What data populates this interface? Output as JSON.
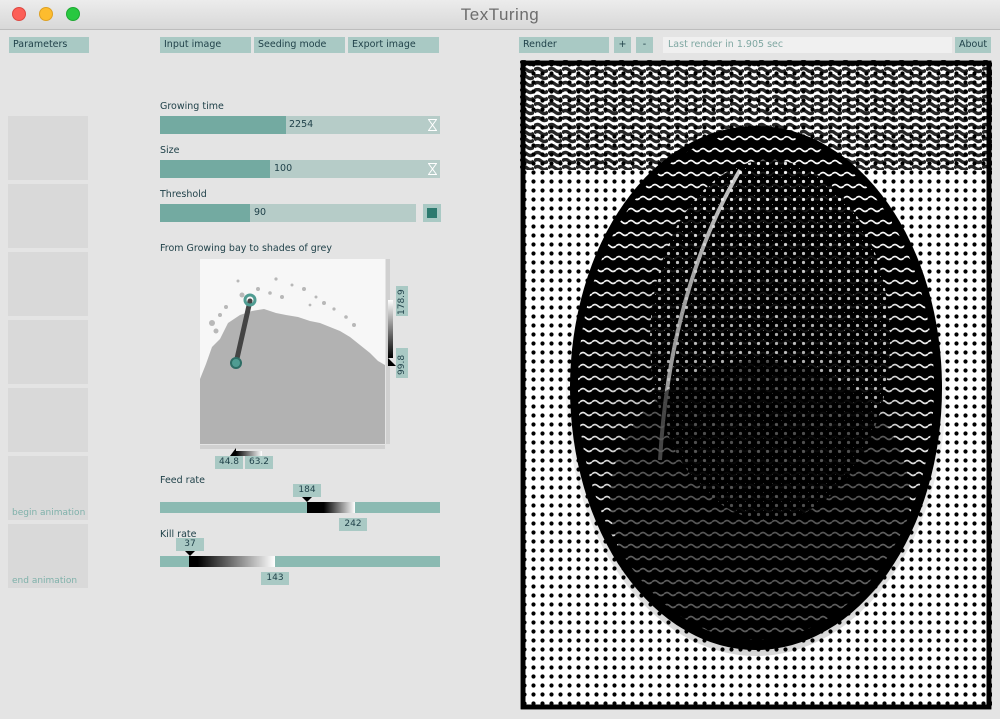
{
  "window": {
    "title": "TexTuring"
  },
  "toolbar": {
    "parameters": "Parameters",
    "input_image": "Input image",
    "seeding_mode": "Seeding mode",
    "export_image": "Export image",
    "render": "Render",
    "plus": "+",
    "minus": "-",
    "status": "Last render in 1.905 sec",
    "about": "About"
  },
  "presets": {
    "begin_animation": "begin animation",
    "end_animation": "end animation"
  },
  "params": {
    "growing_time": {
      "label": "Growing time",
      "value": "2254",
      "fraction": 0.45
    },
    "size": {
      "label": "Size",
      "value": "100",
      "fraction": 0.39
    },
    "threshold": {
      "label": "Threshold",
      "value": "90",
      "fraction": 0.35
    },
    "grey_map": {
      "label": "From Growing bay to shades of grey",
      "x_low": "44.8",
      "x_high": "63.2",
      "y_high": "178.9",
      "y_low": "99.8"
    },
    "feed_rate": {
      "label": "Feed rate",
      "low": "184",
      "high": "242"
    },
    "kill_rate": {
      "label": "Kill rate",
      "low": "37",
      "high": "143"
    }
  },
  "colors": {
    "accent": "#73aaa1",
    "accent_light": "#a9c9c4",
    "track": "#b6ccc8",
    "ink": "#21424a",
    "threshold_swatch": "#2d7a6f"
  }
}
